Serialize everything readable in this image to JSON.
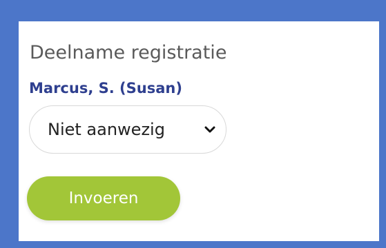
{
  "form": {
    "heading": "Deelname registratie",
    "participant_name": "Marcus, S. (Susan)",
    "attendance_select": {
      "selected": "Niet aanwezig",
      "icon": "chevron-down-icon"
    },
    "submit_label": "Invoeren"
  },
  "colors": {
    "frame_border": "#4c76c9",
    "participant_text": "#2e3f8f",
    "submit_button": "#a2c638",
    "heading_text": "#5a5a5a"
  }
}
